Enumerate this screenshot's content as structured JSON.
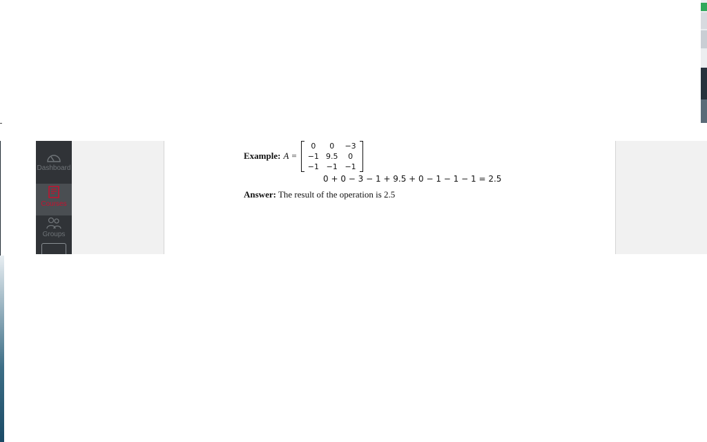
{
  "nav": {
    "dashboard": "Dashboard",
    "courses": "Courses",
    "groups": "Groups"
  },
  "example": {
    "label": "Example:",
    "variable": "A",
    "equals": "=",
    "matrix": [
      [
        "0",
        "0",
        "−3"
      ],
      [
        "−1",
        "9.5",
        "0"
      ],
      [
        "−1",
        "−1",
        "−1"
      ]
    ],
    "sum": "0 + 0 − 3 − 1 + 9.5 + 0 − 1 − 1 − 1 = 2.5"
  },
  "answer": {
    "label": "Answer:",
    "text": "The result of the operation is 2.5"
  },
  "colors": {
    "nav_bg": "#303337",
    "active_accent": "#c8102e",
    "panel_bg": "#f1f1f1"
  }
}
